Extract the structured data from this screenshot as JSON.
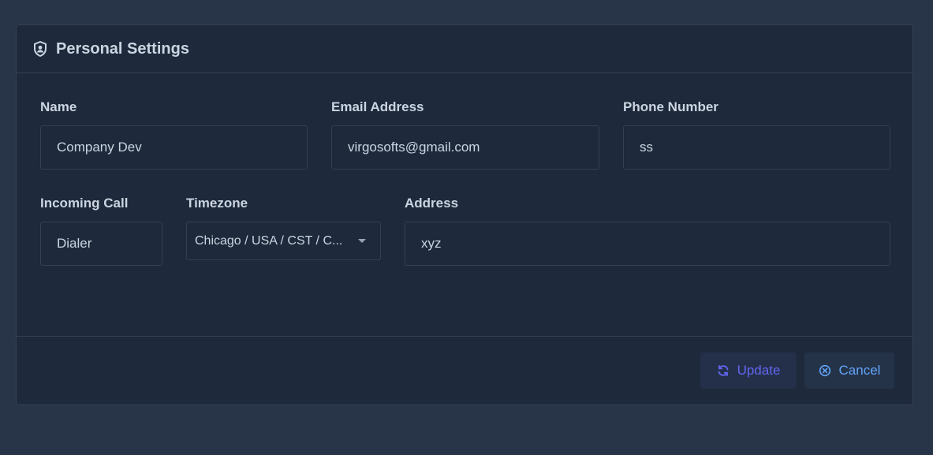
{
  "header": {
    "title": "Personal Settings",
    "icon": "shield-user-icon"
  },
  "form": {
    "name": {
      "label": "Name",
      "value": "Company Dev"
    },
    "email": {
      "label": "Email Address",
      "value": "virgosofts@gmail.com"
    },
    "phone": {
      "label": "Phone Number",
      "value": "ss"
    },
    "incoming_call": {
      "label": "Incoming Call",
      "value": "Dialer"
    },
    "timezone": {
      "label": "Timezone",
      "value": "Chicago / USA / CST / C..."
    },
    "address": {
      "label": "Address",
      "value": "xyz"
    }
  },
  "footer": {
    "update_label": "Update",
    "cancel_label": "Cancel",
    "update_icon": "refresh-icon",
    "cancel_icon": "close-circle-icon"
  },
  "colors": {
    "page_bg": "#283549",
    "card_bg": "#1e293b",
    "border": "#334155",
    "update_accent": "#6366f1",
    "cancel_accent": "#60a5fa"
  }
}
